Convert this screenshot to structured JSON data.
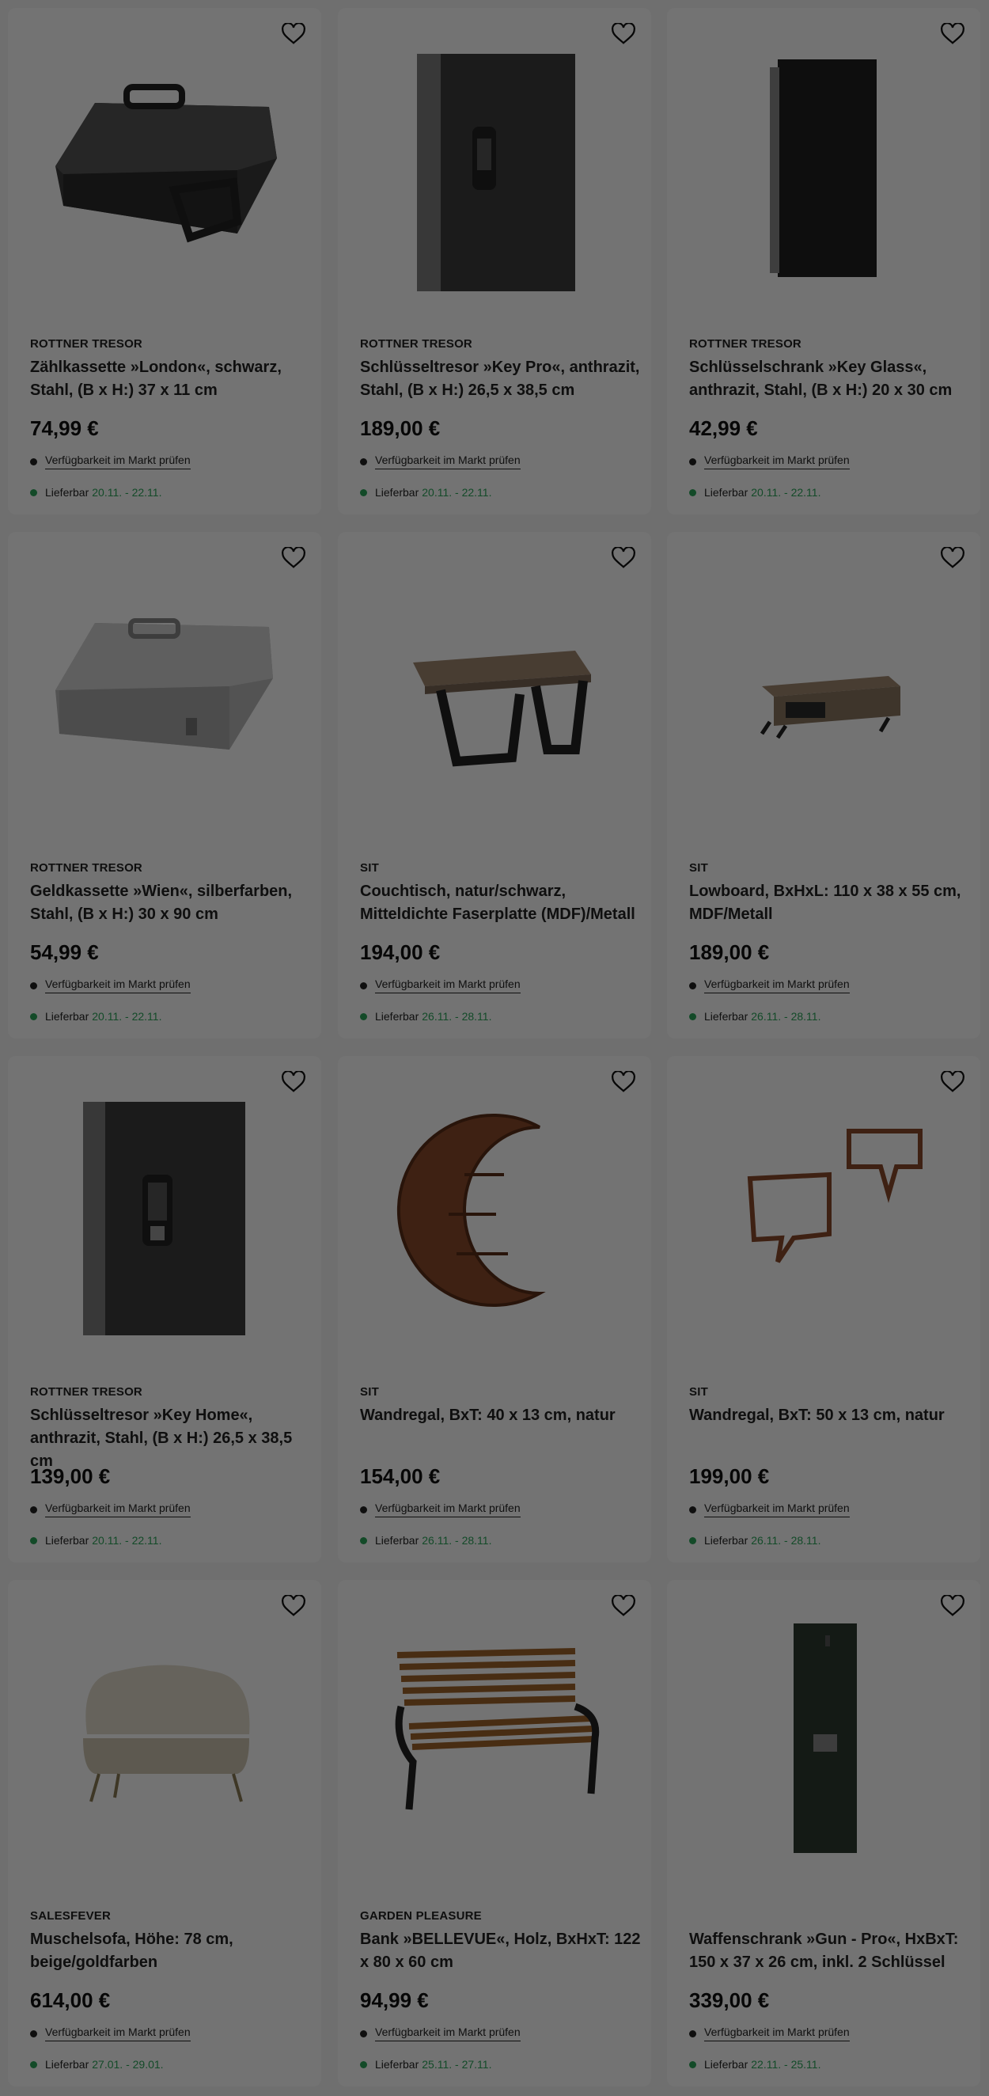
{
  "colors": {
    "accent_green": "#2aa55a",
    "overlay": "rgba(0,0,0,0.55)"
  },
  "labels": {
    "availability_check": "Verfügbarkeit im Markt prüfen",
    "delivery_prefix": "Lieferbar"
  },
  "products": [
    {
      "brand": "ROTTNER TRESOR",
      "title": "Zählkassette »London«, schwarz, Stahl, (B x H:) 37 x 11 cm",
      "price": "74,99 €",
      "delivery": "20.11. - 22.11.",
      "image": "cashbox-black"
    },
    {
      "brand": "ROTTNER TRESOR",
      "title": "Schlüsseltresor »Key Pro«, anthrazit, Stahl, (B x H:) 26,5 x 38,5 cm",
      "price": "189,00 €",
      "delivery": "20.11. - 22.11.",
      "image": "key-safe"
    },
    {
      "brand": "ROTTNER TRESOR",
      "title": "Schlüsselschrank »Key Glass«, anthrazit, Stahl, (B x H:) 20 x 30 cm",
      "price": "42,99 €",
      "delivery": "20.11. - 22.11.",
      "image": "key-cabinet-glass"
    },
    {
      "brand": "ROTTNER TRESOR",
      "title": "Geldkassette »Wien«, silberfarben, Stahl, (B x H:) 30 x 90 cm",
      "price": "54,99 €",
      "delivery": "20.11. - 22.11.",
      "image": "cashbox-silver"
    },
    {
      "brand": "SIT",
      "title": "Couchtisch, natur/schwarz, Mitteldichte Faserplatte (MDF)/Metall",
      "price": "194,00 €",
      "delivery": "26.11. - 28.11.",
      "image": "coffee-table"
    },
    {
      "brand": "SIT",
      "title": "Lowboard, BxHxL: 110 x 38 x 55 cm, MDF/Metall",
      "price": "189,00 €",
      "delivery": "26.11. - 28.11.",
      "image": "lowboard"
    },
    {
      "brand": "ROTTNER TRESOR",
      "title": "Schlüsseltresor »Key Home«, anthrazit, Stahl, (B x H:) 26,5 x 38,5 cm",
      "price": "139,00 €",
      "delivery": "20.11. - 22.11.",
      "image": "key-safe-home"
    },
    {
      "brand": "SIT",
      "title": "Wandregal, BxT: 40 x 13 cm, natur",
      "price": "154,00 €",
      "delivery": "26.11. - 28.11.",
      "image": "moon-shelf"
    },
    {
      "brand": "SIT",
      "title": "Wandregal, BxT: 50 x 13 cm, natur",
      "price": "199,00 €",
      "delivery": "26.11. - 28.11.",
      "image": "speech-bubble-shelf"
    },
    {
      "brand": "SALESFEVER",
      "title": "Muschelsofa, Höhe: 78 cm, beige/goldfarben",
      "price": "614,00 €",
      "delivery": "27.01. - 29.01.",
      "image": "shell-sofa"
    },
    {
      "brand": "GARDEN PLEASURE",
      "title": "Bank »BELLEVUE«, Holz, BxHxT: 122 x 80 x 60 cm",
      "price": "94,99 €",
      "delivery": "25.11. - 27.11.",
      "image": "garden-bench"
    },
    {
      "brand": "",
      "title": "Waffenschrank »Gun - Pro«, HxBxT: 150 x 37 x 26 cm, inkl. 2 Schlüssel",
      "price": "339,00 €",
      "delivery": "22.11. - 25.11.",
      "image": "gun-cabinet"
    }
  ]
}
